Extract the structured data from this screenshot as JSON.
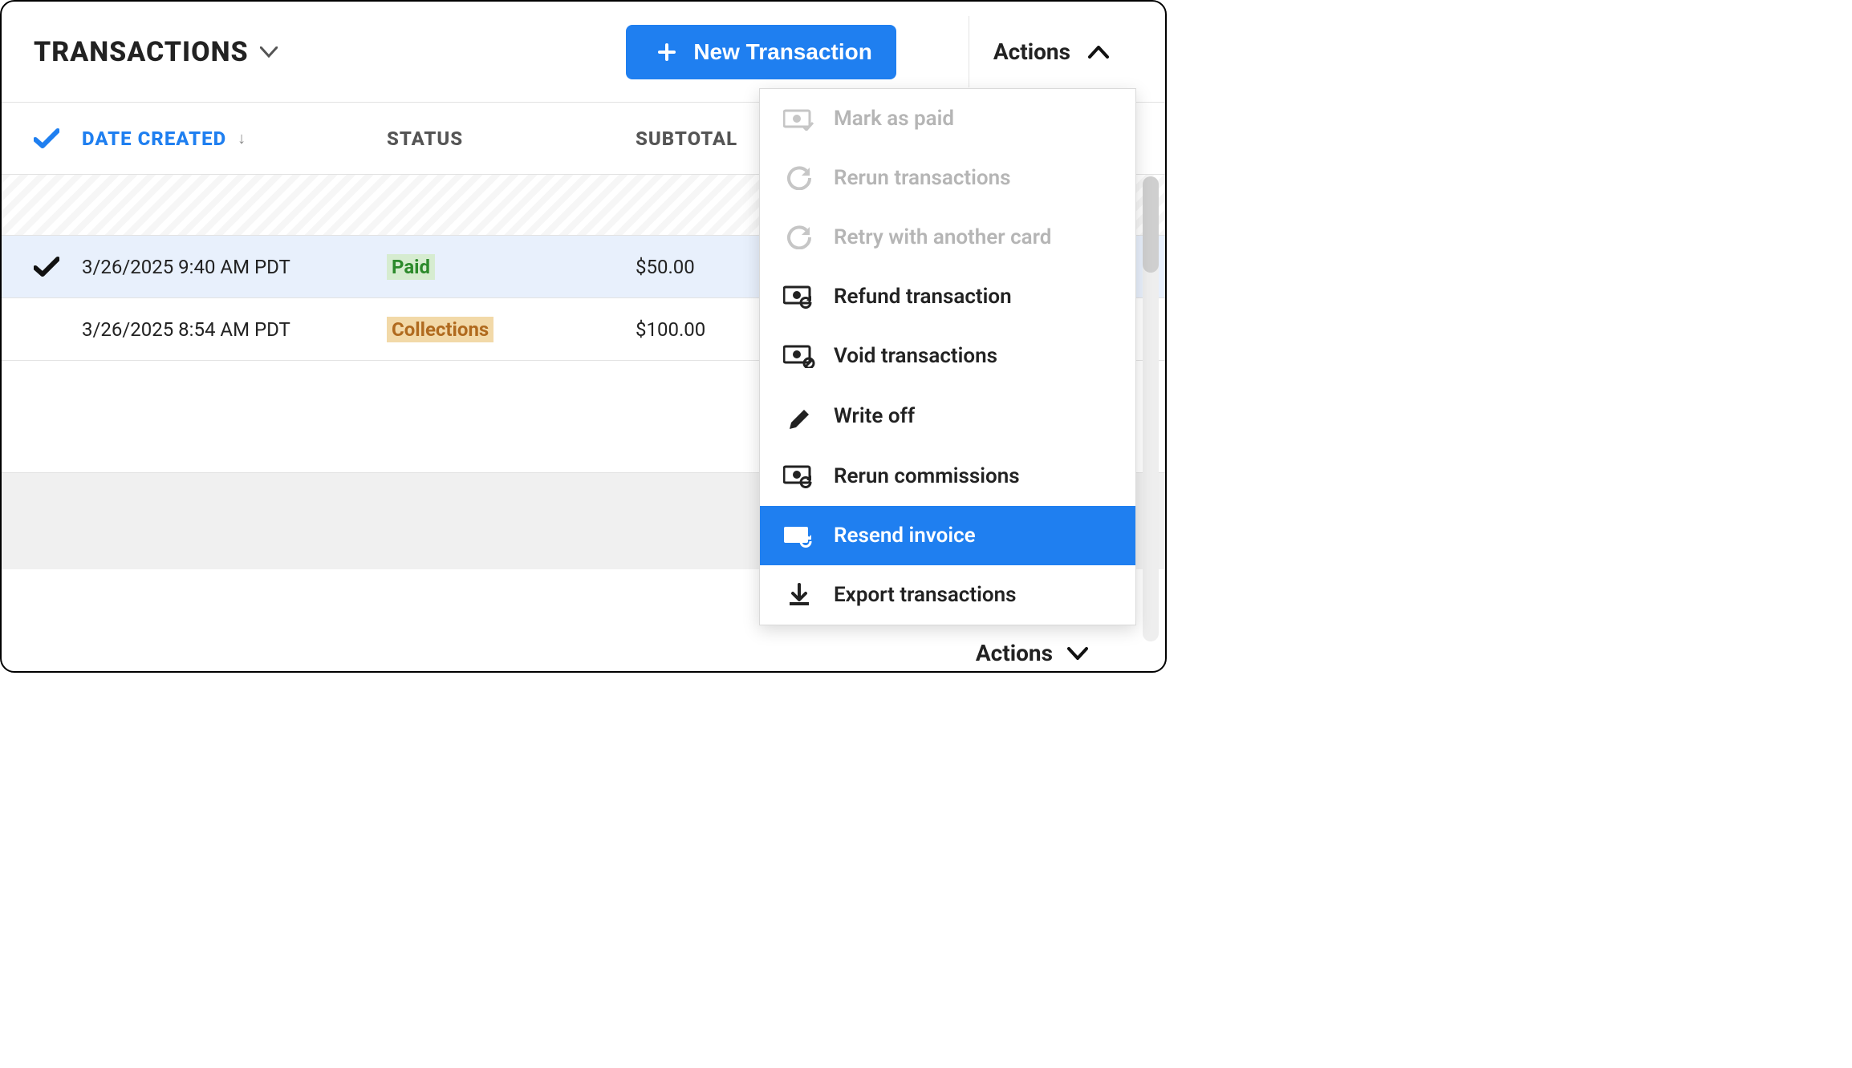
{
  "header": {
    "title": "Transactions",
    "new_button": "New Transaction",
    "actions_label": "Actions"
  },
  "columns": {
    "date": "Date Created",
    "status": "Status",
    "subtotal": "Subtotal"
  },
  "rows": [
    {
      "date": "3/26/2025 9:40 AM PDT",
      "status": "Paid",
      "status_kind": "paid",
      "subtotal": "$50.00",
      "selected": true
    },
    {
      "date": "3/26/2025 8:54 AM PDT",
      "status": "Collections",
      "status_kind": "collections",
      "subtotal": "$100.00",
      "selected": false
    }
  ],
  "actions_menu": [
    {
      "label": "Mark as paid",
      "icon": "money-check-icon",
      "disabled": true
    },
    {
      "label": "Rerun transactions",
      "icon": "refresh-icon",
      "disabled": true
    },
    {
      "label": "Retry with another card",
      "icon": "refresh-icon",
      "disabled": true
    },
    {
      "label": "Refund transaction",
      "icon": "money-rerun-icon",
      "disabled": false
    },
    {
      "label": "Void transactions",
      "icon": "money-void-icon",
      "disabled": false
    },
    {
      "label": "Write off",
      "icon": "pencil-icon",
      "disabled": false
    },
    {
      "label": "Rerun commissions",
      "icon": "money-rerun-icon",
      "disabled": false
    },
    {
      "label": "Resend invoice",
      "icon": "mail-resend-icon",
      "disabled": false,
      "hover": true
    },
    {
      "label": "Export transactions",
      "icon": "download-icon",
      "disabled": false
    }
  ],
  "footer": {
    "actions_label": "Actions"
  }
}
